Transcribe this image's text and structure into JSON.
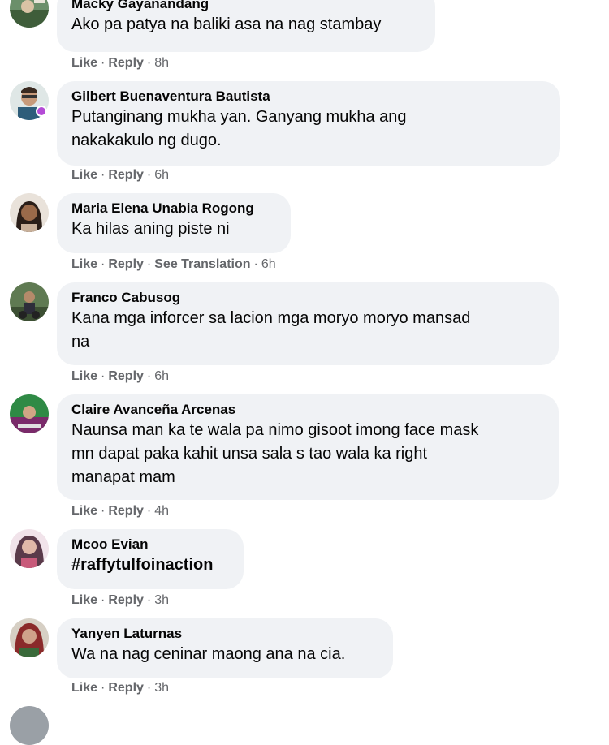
{
  "actions": {
    "like": "Like",
    "reply": "Reply",
    "see_translation": "See Translation",
    "separator": "·"
  },
  "comments": [
    {
      "author": "Macky Gayanandang",
      "text": "Ako pa patya na baliki asa na nag stambay",
      "time": "8h"
    },
    {
      "author": "Gilbert Buenaventura Bautista",
      "text": "Putanginang mukha yan. Ganyang mukha ang\nnakakakulo ng dugo.",
      "time": "6h"
    },
    {
      "author": "Maria Elena Unabia Rogong",
      "text": "Ka hilas aning piste ni",
      "time": "6h"
    },
    {
      "author": "Franco Cabusog",
      "text": "Kana mga inforcer sa lacion mga moryo moryo mansad\nna",
      "time": "6h"
    },
    {
      "author": "Claire Avanceña Arcenas",
      "text": "Naunsa man ka te wala pa nimo gisoot imong face mask\nmn dapat paka kahit unsa sala s tao wala ka right\nmanapat mam",
      "time": "4h"
    },
    {
      "author": "Mcoo Evian",
      "text": "#raffytulfoinaction",
      "time": "3h"
    },
    {
      "author": "Yanyen Laturnas",
      "text": "Wa na nag ceninar maong ana na cia.",
      "time": "3h"
    }
  ]
}
